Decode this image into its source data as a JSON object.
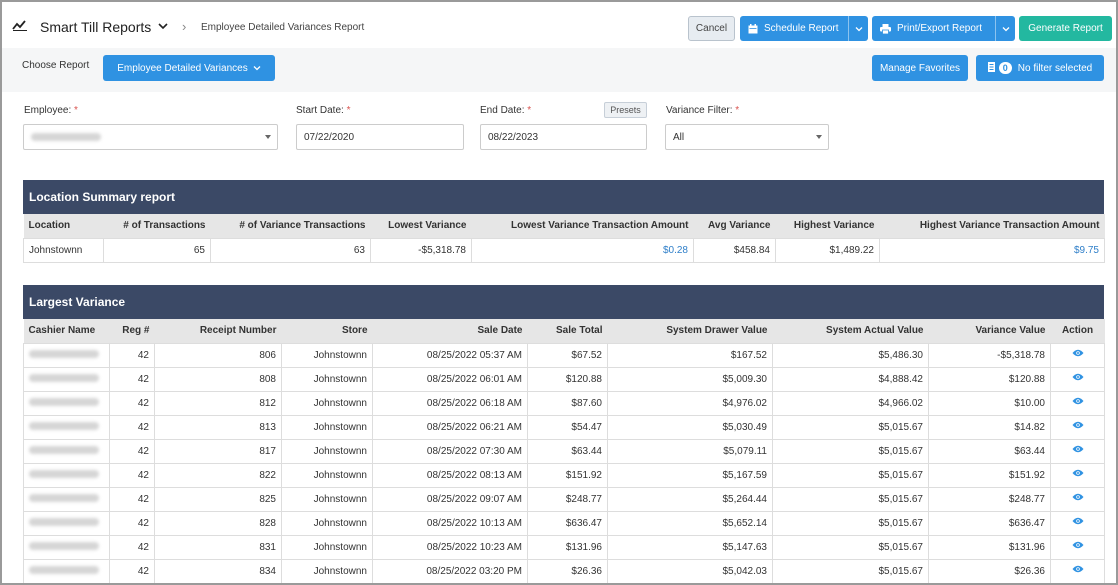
{
  "header": {
    "app_title": "Smart Till Reports",
    "breadcrumb": "Employee Detailed Variances Report",
    "cancel_label": "Cancel",
    "schedule_label": "Schedule Report",
    "print_label": "Print/Export Report",
    "generate_label": "Generate Report"
  },
  "choose": {
    "label": "Choose Report",
    "report_selected": "Employee Detailed Variances",
    "favorites_label": "Manage Favorites",
    "filter_count": "0",
    "filter_label": "No filter selected"
  },
  "filters": {
    "employee_label": "Employee:",
    "start_label": "Start Date:",
    "start_value": "07/22/2020",
    "end_label": "End Date:",
    "end_value": "08/22/2023",
    "presets_label": "Presets",
    "variance_label": "Variance Filter:",
    "variance_value": "All",
    "required_mark": "*"
  },
  "colors": {
    "primary": "#2f92e2",
    "success": "#23b8a0",
    "table_header": "#3b4966",
    "link": "#2f7fc9",
    "required": "#d9534f"
  },
  "location_summary": {
    "title": "Location Summary report",
    "columns": [
      "Location",
      "# of Transactions",
      "# of Variance Transactions",
      "Lowest Variance",
      "Lowest Variance Transaction Amount",
      "Avg Variance",
      "Highest Variance",
      "Highest Variance Transaction Amount"
    ],
    "row": [
      "Johnstownn",
      "65",
      "63",
      "-$5,318.78",
      "$0.28",
      "$458.84",
      "$1,489.22",
      "$9.75"
    ]
  },
  "largest_variance": {
    "title": "Largest Variance",
    "columns": [
      "Cashier Name",
      "Reg #",
      "Receipt Number",
      "Store",
      "Sale Date",
      "Sale Total",
      "System Drawer Value",
      "System Actual Value",
      "Variance Value",
      "Action"
    ],
    "rows": [
      [
        "42",
        "806",
        "Johnstownn",
        "08/25/2022 05:37 AM",
        "$67.52",
        "$167.52",
        "$5,486.30",
        "-$5,318.78"
      ],
      [
        "42",
        "808",
        "Johnstownn",
        "08/25/2022 06:01 AM",
        "$120.88",
        "$5,009.30",
        "$4,888.42",
        "$120.88"
      ],
      [
        "42",
        "812",
        "Johnstownn",
        "08/25/2022 06:18 AM",
        "$87.60",
        "$4,976.02",
        "$4,966.02",
        "$10.00"
      ],
      [
        "42",
        "813",
        "Johnstownn",
        "08/25/2022 06:21 AM",
        "$54.47",
        "$5,030.49",
        "$5,015.67",
        "$14.82"
      ],
      [
        "42",
        "817",
        "Johnstownn",
        "08/25/2022 07:30 AM",
        "$63.44",
        "$5,079.11",
        "$5,015.67",
        "$63.44"
      ],
      [
        "42",
        "822",
        "Johnstownn",
        "08/25/2022 08:13 AM",
        "$151.92",
        "$5,167.59",
        "$5,015.67",
        "$151.92"
      ],
      [
        "42",
        "825",
        "Johnstownn",
        "08/25/2022 09:07 AM",
        "$248.77",
        "$5,264.44",
        "$5,015.67",
        "$248.77"
      ],
      [
        "42",
        "828",
        "Johnstownn",
        "08/25/2022 10:13 AM",
        "$636.47",
        "$5,652.14",
        "$5,015.67",
        "$636.47"
      ],
      [
        "42",
        "831",
        "Johnstownn",
        "08/25/2022 10:23 AM",
        "$131.96",
        "$5,147.63",
        "$5,015.67",
        "$131.96"
      ],
      [
        "42",
        "834",
        "Johnstownn",
        "08/25/2022 03:20 PM",
        "$26.36",
        "$5,042.03",
        "$5,015.67",
        "$26.36"
      ]
    ]
  },
  "icons": {
    "app": "line-chart-icon",
    "schedule": "calendar-icon",
    "print": "printer-icon",
    "filter": "filter-icon",
    "action": "eye-icon"
  }
}
